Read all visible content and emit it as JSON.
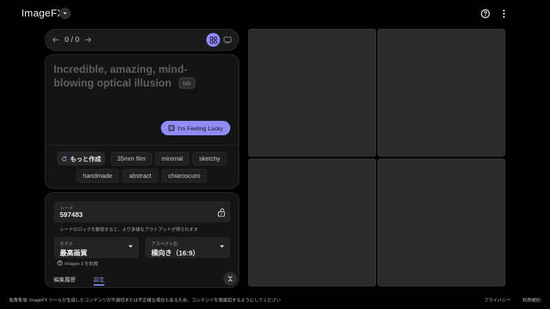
{
  "header": {
    "app_title": "ImageFX",
    "switcher_icon": "chevron-down-icon",
    "help_icon": "help-circle-icon",
    "more_icon": "more-vert-icon"
  },
  "navigation": {
    "counter": "0 / 0",
    "prev_icon": "arrow-left-icon",
    "next_icon": "arrow-right-icon",
    "view_grid_icon": "grid-view-icon",
    "view_single_icon": "single-view-icon",
    "active_view": "grid"
  },
  "prompt": {
    "text": "Incredible, amazing, mind-blowing optical illusion",
    "tab_hint": "tab",
    "lucky_button": "I'm Feeling Lucky",
    "lucky_icon": "dice-icon"
  },
  "chips": {
    "more_button": "もっと作成",
    "more_icon": "refresh-icon",
    "styles": [
      "35mm film",
      "minimal",
      "sketchy",
      "handmade",
      "abstract",
      "chiaroscuro"
    ]
  },
  "settings": {
    "seed_label": "シード",
    "seed_value": "597483",
    "seed_lock_icon": "unlock-icon",
    "seed_hint": "シードのロックを解除すると、より多様なアウトプットが得られます",
    "model_label": "モデル",
    "model_value": "最高画質",
    "aspect_label": "アスペクト比",
    "aspect_value": "横向き（16:9）",
    "model_note": "Imagen 3 を利用",
    "model_note_icon": "help-circle-icon",
    "tab_history": "編集履歴",
    "tab_settings": "設定",
    "active_tab": "settings",
    "collapse_icon": "collapse-icon"
  },
  "gallery": {
    "slot_count": 4
  },
  "footer": {
    "disclaimer": "免責条項: ImageFX ツールが生成したコンテンツが不適切または不正確な場合もあるため、コンテンツを再確認するようにしてください",
    "privacy": "プライバシー",
    "terms": "利用規約"
  },
  "colors": {
    "background": "#000000",
    "panel": "#141414",
    "accent": "#8f8cf5",
    "placeholder": "#2b2b2b",
    "prompt_text": "#5f5f5f"
  }
}
